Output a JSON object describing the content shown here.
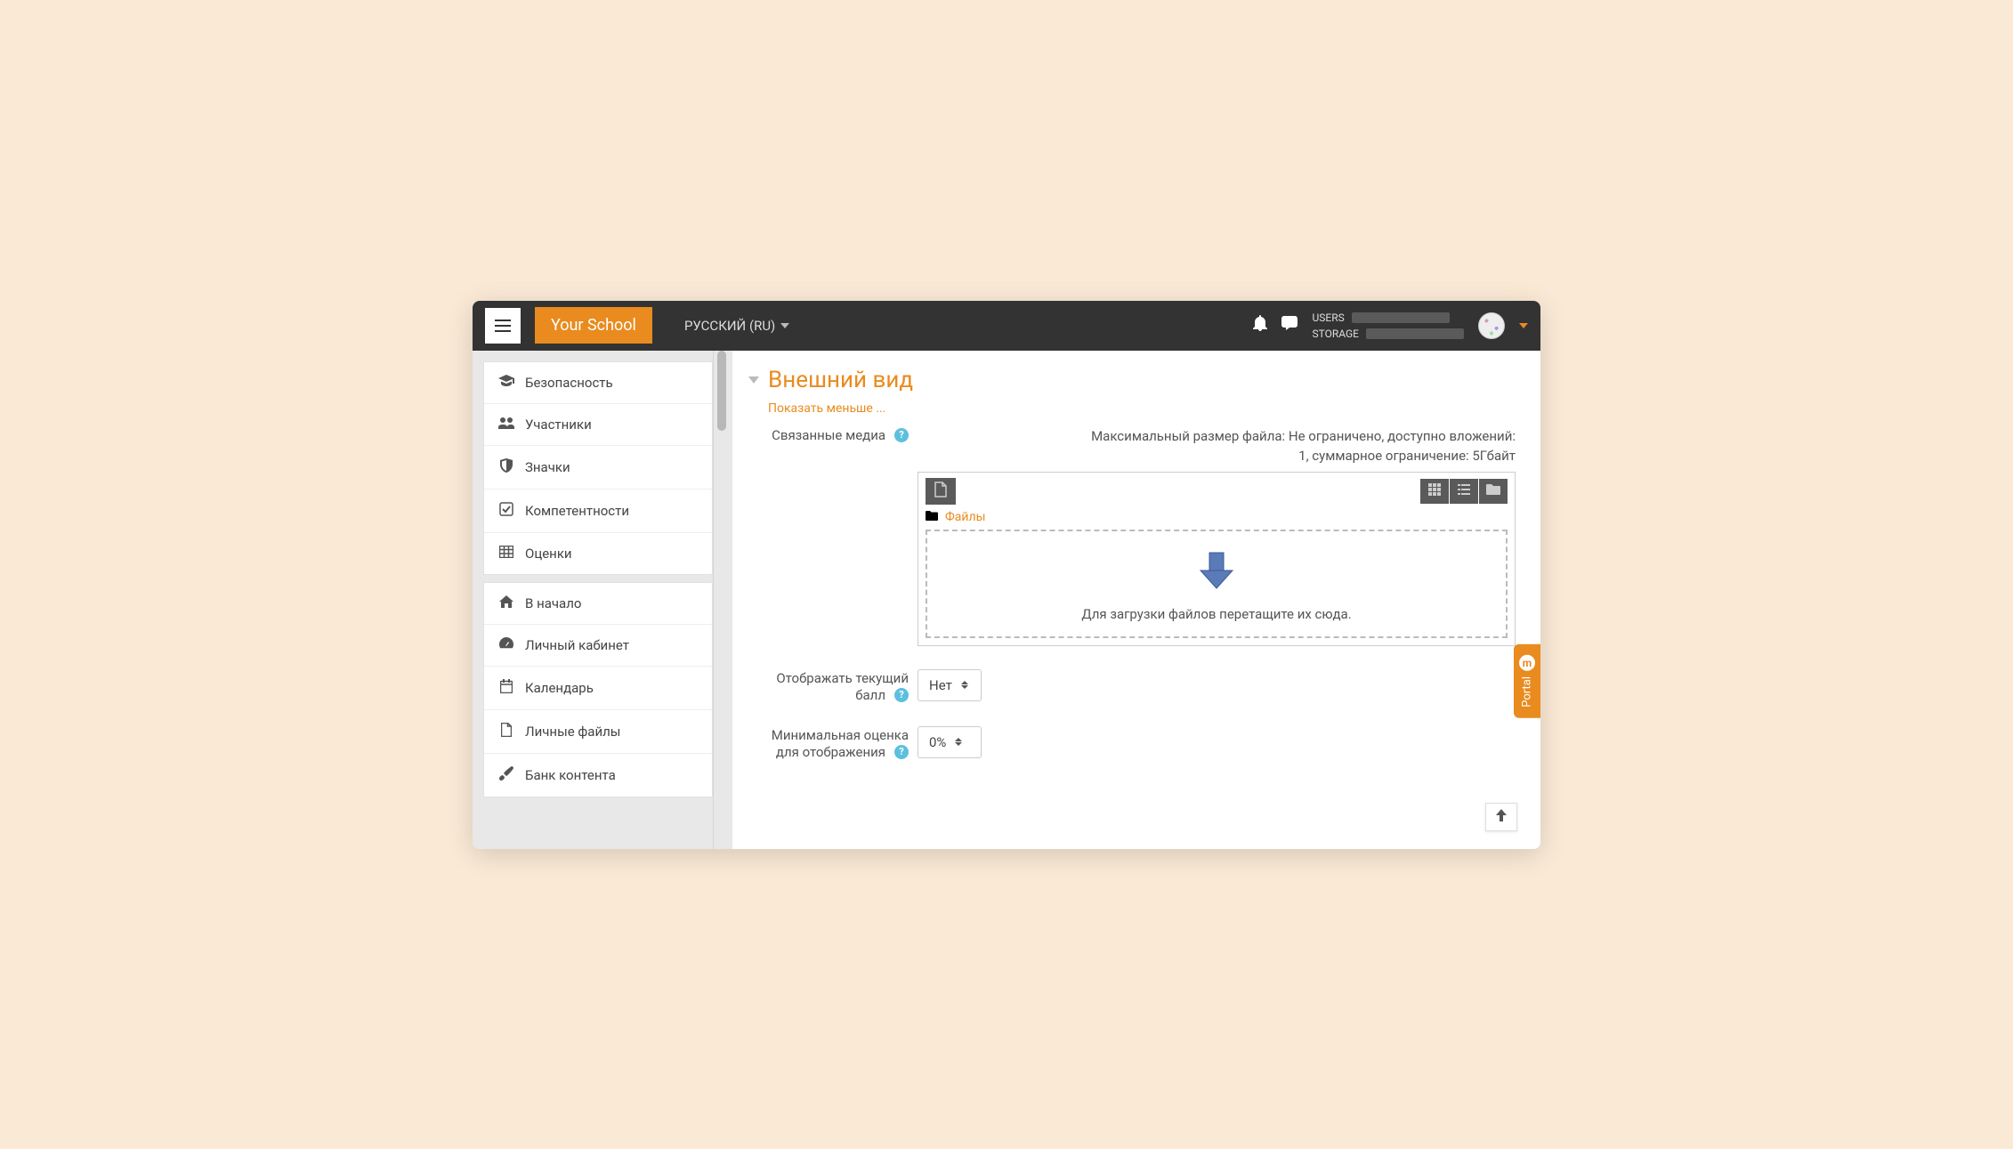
{
  "topbar": {
    "brand": "Your School",
    "language": "РУССКИЙ (RU)",
    "usage": {
      "users_label": "USERS",
      "storage_label": "STORAGE"
    }
  },
  "sidebar": {
    "group1": [
      {
        "icon": "graduation-cap",
        "label": "Безопасность"
      },
      {
        "icon": "users",
        "label": "Участники"
      },
      {
        "icon": "shield",
        "label": "Значки"
      },
      {
        "icon": "check-square",
        "label": "Компетентности"
      },
      {
        "icon": "table",
        "label": "Оценки"
      }
    ],
    "group2": [
      {
        "icon": "home",
        "label": "В начало"
      },
      {
        "icon": "tachometer",
        "label": "Личный кабинет"
      },
      {
        "icon": "calendar",
        "label": "Календарь"
      },
      {
        "icon": "file",
        "label": "Личные файлы"
      },
      {
        "icon": "paint-brush",
        "label": "Банк контента"
      }
    ]
  },
  "main": {
    "section_title": "Внешний вид",
    "show_less": "Показать меньше ...",
    "media": {
      "label": "Связанные медиа",
      "limit_line1": "Максимальный размер файла: Не ограничено, доступно вложений:",
      "limit_line2": "1, суммарное ограничение: 5Гбайт",
      "breadcrumb": "Файлы",
      "dropzone": "Для загрузки файлов перетащите их сюда."
    },
    "current_grade": {
      "label": "Отображать текущий балл",
      "value": "Нет"
    },
    "min_grade": {
      "label": "Минимальная оценка для отображения",
      "value": "0%"
    }
  },
  "portal_tab": "Portal"
}
